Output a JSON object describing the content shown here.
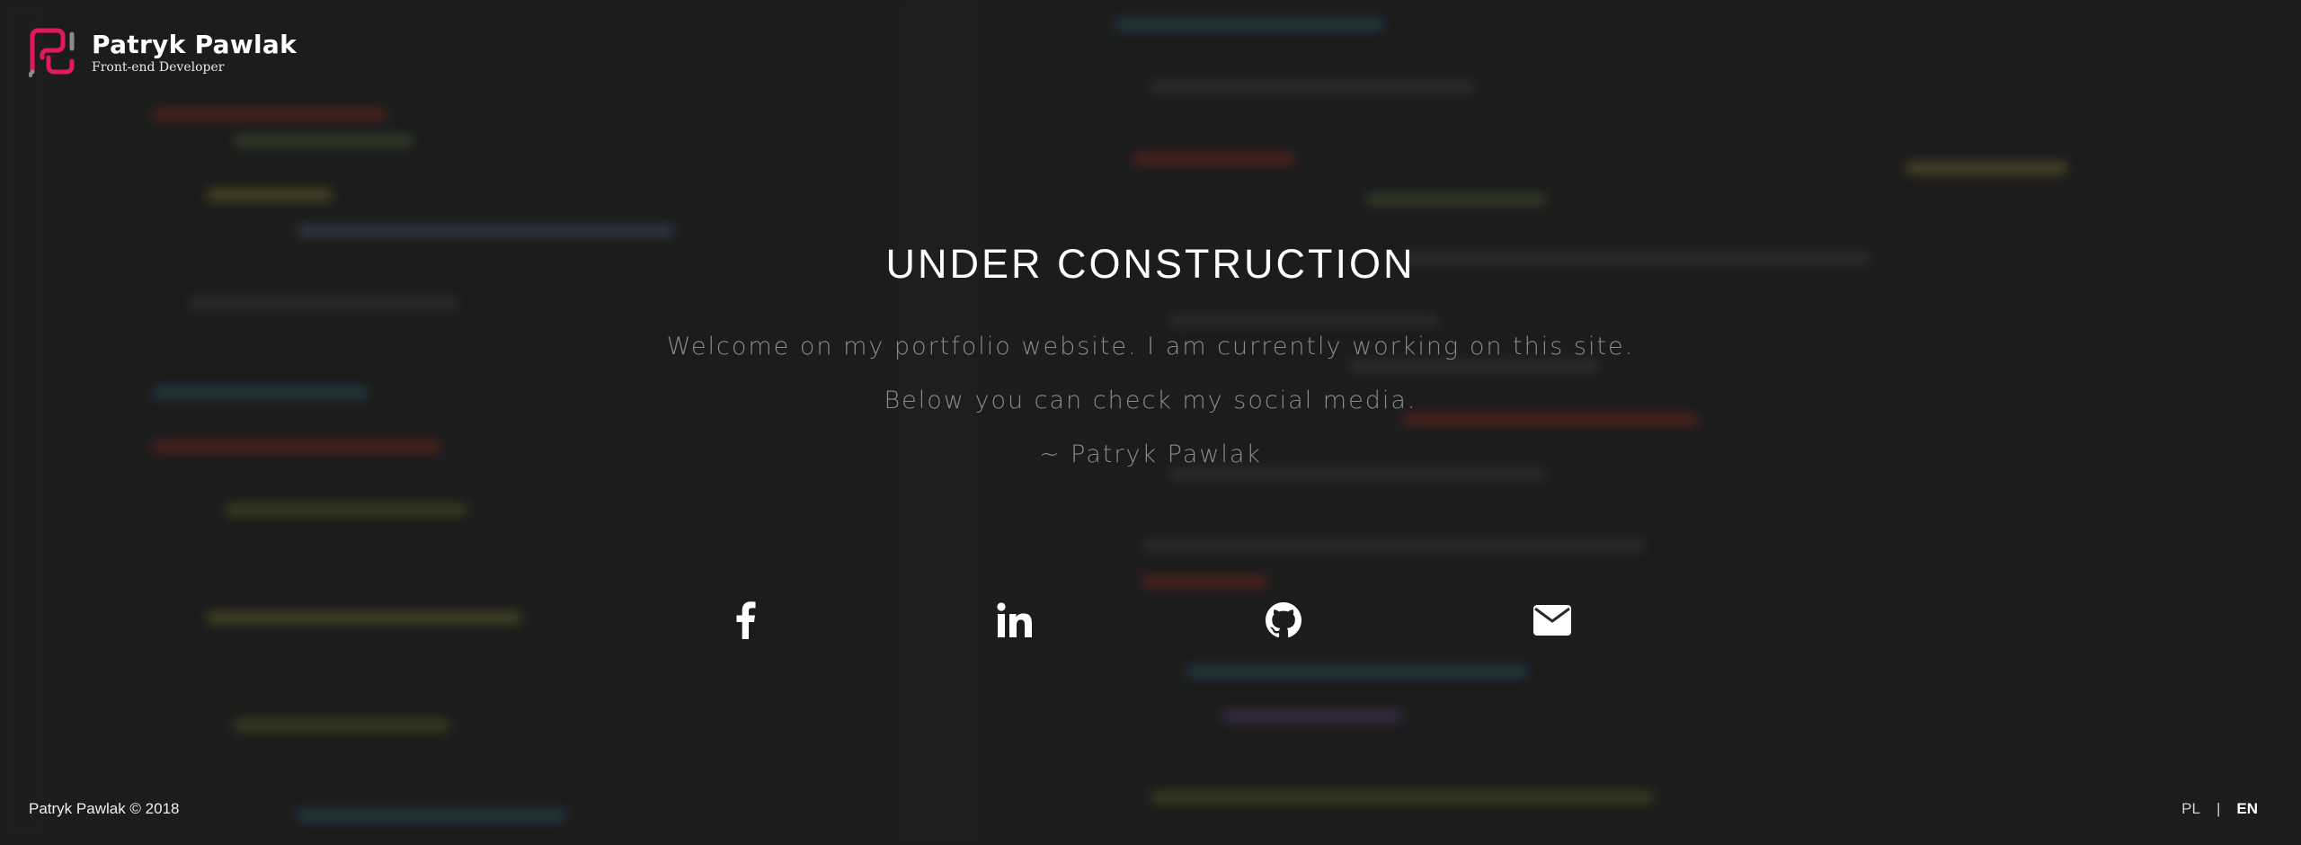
{
  "brand": {
    "name": "Patryk Pawlak",
    "role": "Front-end Developer",
    "accent_color": "#e5185a"
  },
  "main": {
    "title": "UNDER CONSTRUCTION",
    "lines": [
      "Welcome on my portfolio website. I am currently working on this site.",
      "Below you can check my social media.",
      "~ Patryk Pawlak"
    ]
  },
  "socials": [
    {
      "icon": "facebook-icon"
    },
    {
      "icon": "linkedin-icon"
    },
    {
      "icon": "github-icon"
    },
    {
      "icon": "envelope-icon"
    }
  ],
  "footer": {
    "copyright": "Patryk Pawlak © 2018",
    "lang_pl": "PL",
    "lang_separator": "|",
    "lang_en": "EN"
  }
}
